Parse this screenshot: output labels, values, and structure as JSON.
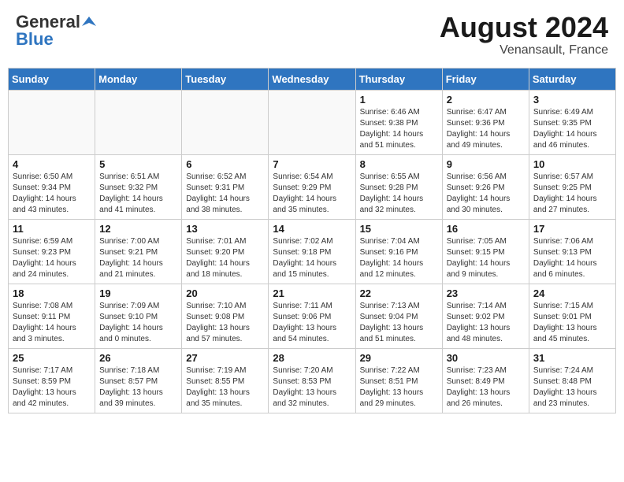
{
  "header": {
    "logo_general": "General",
    "logo_blue": "Blue",
    "month_year": "August 2024",
    "location": "Venansault, France"
  },
  "weekdays": [
    "Sunday",
    "Monday",
    "Tuesday",
    "Wednesday",
    "Thursday",
    "Friday",
    "Saturday"
  ],
  "weeks": [
    [
      {
        "day": "",
        "info": ""
      },
      {
        "day": "",
        "info": ""
      },
      {
        "day": "",
        "info": ""
      },
      {
        "day": "",
        "info": ""
      },
      {
        "day": "1",
        "info": "Sunrise: 6:46 AM\nSunset: 9:38 PM\nDaylight: 14 hours\nand 51 minutes."
      },
      {
        "day": "2",
        "info": "Sunrise: 6:47 AM\nSunset: 9:36 PM\nDaylight: 14 hours\nand 49 minutes."
      },
      {
        "day": "3",
        "info": "Sunrise: 6:49 AM\nSunset: 9:35 PM\nDaylight: 14 hours\nand 46 minutes."
      }
    ],
    [
      {
        "day": "4",
        "info": "Sunrise: 6:50 AM\nSunset: 9:34 PM\nDaylight: 14 hours\nand 43 minutes."
      },
      {
        "day": "5",
        "info": "Sunrise: 6:51 AM\nSunset: 9:32 PM\nDaylight: 14 hours\nand 41 minutes."
      },
      {
        "day": "6",
        "info": "Sunrise: 6:52 AM\nSunset: 9:31 PM\nDaylight: 14 hours\nand 38 minutes."
      },
      {
        "day": "7",
        "info": "Sunrise: 6:54 AM\nSunset: 9:29 PM\nDaylight: 14 hours\nand 35 minutes."
      },
      {
        "day": "8",
        "info": "Sunrise: 6:55 AM\nSunset: 9:28 PM\nDaylight: 14 hours\nand 32 minutes."
      },
      {
        "day": "9",
        "info": "Sunrise: 6:56 AM\nSunset: 9:26 PM\nDaylight: 14 hours\nand 30 minutes."
      },
      {
        "day": "10",
        "info": "Sunrise: 6:57 AM\nSunset: 9:25 PM\nDaylight: 14 hours\nand 27 minutes."
      }
    ],
    [
      {
        "day": "11",
        "info": "Sunrise: 6:59 AM\nSunset: 9:23 PM\nDaylight: 14 hours\nand 24 minutes."
      },
      {
        "day": "12",
        "info": "Sunrise: 7:00 AM\nSunset: 9:21 PM\nDaylight: 14 hours\nand 21 minutes."
      },
      {
        "day": "13",
        "info": "Sunrise: 7:01 AM\nSunset: 9:20 PM\nDaylight: 14 hours\nand 18 minutes."
      },
      {
        "day": "14",
        "info": "Sunrise: 7:02 AM\nSunset: 9:18 PM\nDaylight: 14 hours\nand 15 minutes."
      },
      {
        "day": "15",
        "info": "Sunrise: 7:04 AM\nSunset: 9:16 PM\nDaylight: 14 hours\nand 12 minutes."
      },
      {
        "day": "16",
        "info": "Sunrise: 7:05 AM\nSunset: 9:15 PM\nDaylight: 14 hours\nand 9 minutes."
      },
      {
        "day": "17",
        "info": "Sunrise: 7:06 AM\nSunset: 9:13 PM\nDaylight: 14 hours\nand 6 minutes."
      }
    ],
    [
      {
        "day": "18",
        "info": "Sunrise: 7:08 AM\nSunset: 9:11 PM\nDaylight: 14 hours\nand 3 minutes."
      },
      {
        "day": "19",
        "info": "Sunrise: 7:09 AM\nSunset: 9:10 PM\nDaylight: 14 hours\nand 0 minutes."
      },
      {
        "day": "20",
        "info": "Sunrise: 7:10 AM\nSunset: 9:08 PM\nDaylight: 13 hours\nand 57 minutes."
      },
      {
        "day": "21",
        "info": "Sunrise: 7:11 AM\nSunset: 9:06 PM\nDaylight: 13 hours\nand 54 minutes."
      },
      {
        "day": "22",
        "info": "Sunrise: 7:13 AM\nSunset: 9:04 PM\nDaylight: 13 hours\nand 51 minutes."
      },
      {
        "day": "23",
        "info": "Sunrise: 7:14 AM\nSunset: 9:02 PM\nDaylight: 13 hours\nand 48 minutes."
      },
      {
        "day": "24",
        "info": "Sunrise: 7:15 AM\nSunset: 9:01 PM\nDaylight: 13 hours\nand 45 minutes."
      }
    ],
    [
      {
        "day": "25",
        "info": "Sunrise: 7:17 AM\nSunset: 8:59 PM\nDaylight: 13 hours\nand 42 minutes."
      },
      {
        "day": "26",
        "info": "Sunrise: 7:18 AM\nSunset: 8:57 PM\nDaylight: 13 hours\nand 39 minutes."
      },
      {
        "day": "27",
        "info": "Sunrise: 7:19 AM\nSunset: 8:55 PM\nDaylight: 13 hours\nand 35 minutes."
      },
      {
        "day": "28",
        "info": "Sunrise: 7:20 AM\nSunset: 8:53 PM\nDaylight: 13 hours\nand 32 minutes."
      },
      {
        "day": "29",
        "info": "Sunrise: 7:22 AM\nSunset: 8:51 PM\nDaylight: 13 hours\nand 29 minutes."
      },
      {
        "day": "30",
        "info": "Sunrise: 7:23 AM\nSunset: 8:49 PM\nDaylight: 13 hours\nand 26 minutes."
      },
      {
        "day": "31",
        "info": "Sunrise: 7:24 AM\nSunset: 8:48 PM\nDaylight: 13 hours\nand 23 minutes."
      }
    ]
  ]
}
